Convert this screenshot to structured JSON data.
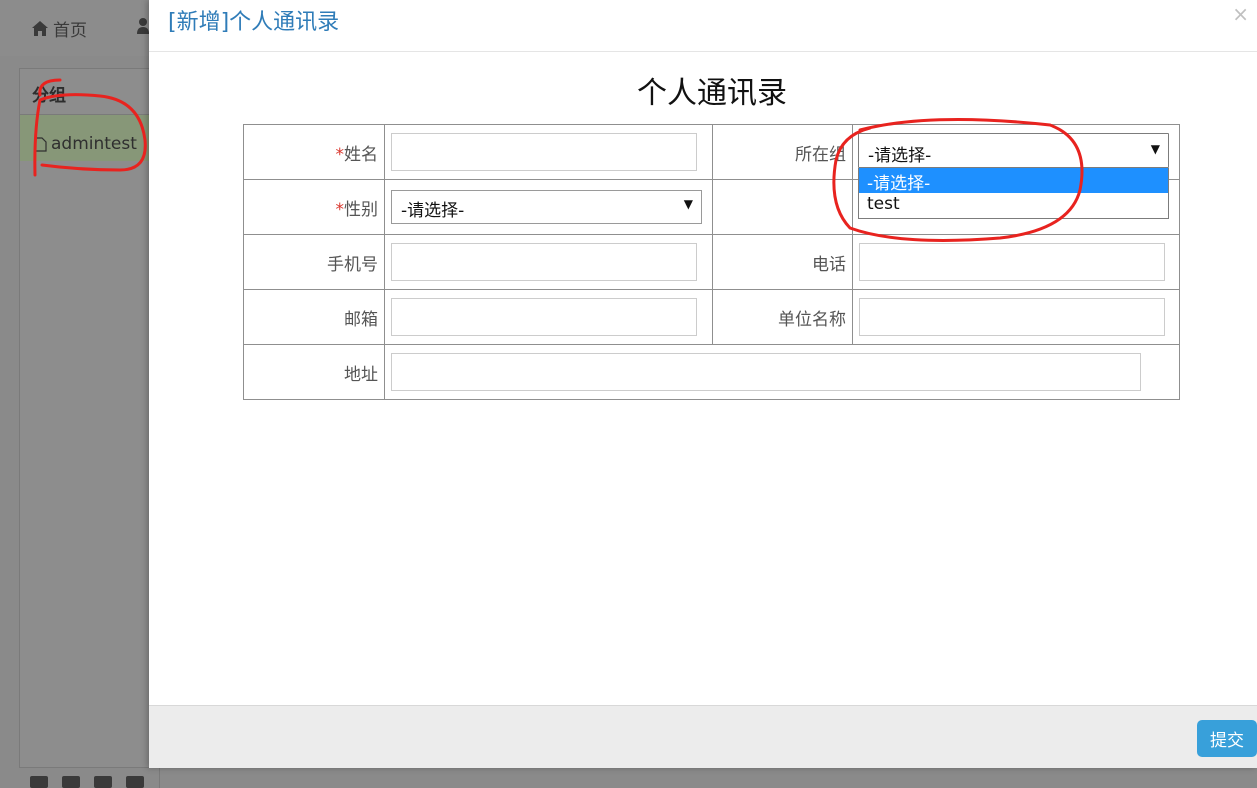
{
  "background": {
    "nav_home_label": "首页",
    "panel_title": "分组",
    "panel_item": "admintest"
  },
  "modal": {
    "title": "[新增]个人通讯录",
    "close_glyph": "×",
    "form_title": "个人通讯录",
    "fields": {
      "name_label": "姓名",
      "group_label": "所在组",
      "gender_label": "性别",
      "mobile_label": "手机号",
      "phone_label": "电话",
      "email_label": "邮箱",
      "company_label": "单位名称",
      "address_label": "地址",
      "required_mark": "*"
    },
    "gender_select": {
      "selected": "-请选择-"
    },
    "group_select": {
      "selected": "-请选择-",
      "options": [
        "-请选择-",
        "test"
      ]
    },
    "submit_label": "提交"
  },
  "colors": {
    "accent": "#38a0da",
    "title": "#2f7cb8",
    "highlight": "#1e90ff",
    "required": "#d9352c",
    "annotation": "#e8231f"
  }
}
